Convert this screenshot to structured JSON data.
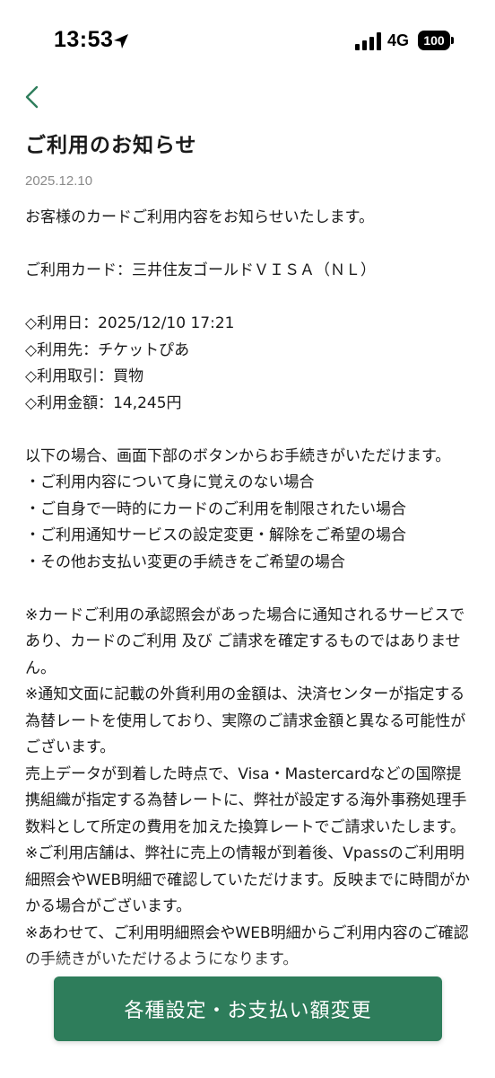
{
  "status_bar": {
    "time": "13:53",
    "network": "4G",
    "battery": "100",
    "icons": [
      "location-arrow-icon",
      "signal-bars-icon",
      "battery-icon"
    ]
  },
  "nav": {
    "back_icon": "chevron-left-icon",
    "accent_color": "#2e7d5b"
  },
  "notice": {
    "title": "ご利用のお知らせ",
    "date": "2025.12.10",
    "intro": "お客様のカードご利用内容をお知らせいたします。",
    "card": "ご利用カード：三井住友ゴールドＶＩＳＡ（ＮＬ）",
    "details": [
      "◇利用日：2025/12/10 17:21",
      "◇利用先：チケットぴあ",
      "◇利用取引：買物",
      "◇利用金額：14,245円"
    ],
    "procedure_intro": "以下の場合、画面下部のボタンからお手続きがいただけます。",
    "procedure_items": [
      "・ご利用内容について身に覚えのない場合",
      "・ご自身で一時的にカードのご利用を制限されたい場合",
      "・ご利用通知サービスの設定変更・解除をご希望の場合",
      "・その他お支払い変更の手続きをご希望の場合"
    ],
    "notes": [
      "※カードご利用の承認照会があった場合に通知されるサービスであり、カードのご利用 及び ご請求を確定するものではありません。",
      "※通知文面に記載の外貨利用の金額は、決済センターが指定する為替レートを使用しており、実際のご請求金額と異なる可能性がございます。",
      "売上データが到着した時点で、Visa・Mastercardなどの国際提携組織が指定する為替レートに、弊社が設定する海外事務処理手数料として所定の費用を加えた換算レートでご請求いたします。",
      "※ご利用店舗は、弊社に売上の情報が到着後、Vpassのご利用明細照会やWEB明細で確認していただけます。反映までに時間がかかる場合がございます。",
      "※あわせて、ご利用明細照会やWEB明細からご利用内容のご確認の手続きがいただけるようになります。"
    ]
  },
  "footer": {
    "button_label": "各種設定・お支払い額変更",
    "button_color": "#2e7d5b"
  }
}
